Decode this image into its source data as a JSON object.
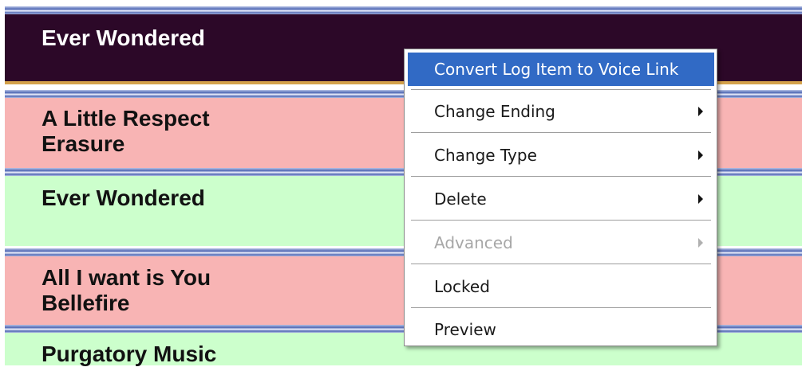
{
  "playlist": {
    "rows": [
      {
        "style": "dark",
        "lines": [
          "Ever Wondered"
        ]
      },
      {
        "style": "pink",
        "lines": [
          "A Little Respect",
          "Erasure"
        ]
      },
      {
        "style": "green",
        "lines": [
          "Ever Wondered"
        ]
      },
      {
        "style": "pink",
        "lines": [
          "All I want is You",
          "Bellefire"
        ]
      },
      {
        "style": "green",
        "lines": [
          "Purgatory Music"
        ]
      }
    ]
  },
  "context_menu": {
    "items": [
      {
        "label": "Convert Log Item to Voice Link",
        "highlighted": true,
        "submenu": false,
        "disabled": false
      },
      {
        "label": "Change Ending",
        "highlighted": false,
        "submenu": true,
        "disabled": false
      },
      {
        "label": "Change Type",
        "highlighted": false,
        "submenu": true,
        "disabled": false
      },
      {
        "label": "Delete",
        "highlighted": false,
        "submenu": true,
        "disabled": false
      },
      {
        "label": "Advanced",
        "highlighted": false,
        "submenu": true,
        "disabled": true
      },
      {
        "label": "Locked",
        "highlighted": false,
        "submenu": false,
        "disabled": false
      },
      {
        "label": "Preview",
        "highlighted": false,
        "submenu": false,
        "disabled": false
      }
    ]
  },
  "colors": {
    "dark_row": "#2c0828",
    "pink_row": "#f8b4b4",
    "green_row": "#ccffcc",
    "menu_highlight": "#316ac5"
  }
}
